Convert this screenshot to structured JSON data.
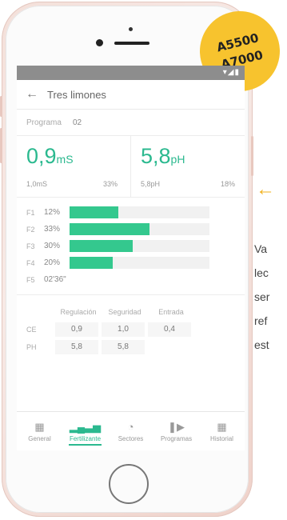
{
  "badge": {
    "line1": "A5500",
    "line2": "A7000"
  },
  "app": {
    "title": "Tres limones",
    "status_icons": "▾◢▮"
  },
  "programa": {
    "label": "Programa",
    "value": "02"
  },
  "ce": {
    "value": "0,9",
    "unit": "mS",
    "set": "1,0mS",
    "percent": "33%"
  },
  "ph": {
    "value": "5,8",
    "unit": "pH",
    "set": "5,8pH",
    "percent": "18%"
  },
  "fertilizers": [
    {
      "label": "F1",
      "percent": "12%",
      "level": 0.35
    },
    {
      "label": "F2",
      "percent": "33%",
      "level": 0.57
    },
    {
      "label": "F3",
      "percent": "30%",
      "level": 0.45
    },
    {
      "label": "F4",
      "percent": "20%",
      "level": 0.31
    }
  ],
  "f5": {
    "label": "F5",
    "time": "02'36\""
  },
  "table": {
    "headers": [
      "Regulación",
      "Seguridad",
      "Entrada"
    ],
    "rows": [
      {
        "label": "CE",
        "values": [
          "0,9",
          "1,0",
          "0,4"
        ]
      },
      {
        "label": "PH",
        "values": [
          "5,8",
          "5,8"
        ]
      }
    ]
  },
  "tabs": [
    {
      "label": "General",
      "icon": "dashboard-icon"
    },
    {
      "label": "Fertilizante",
      "icon": "bars-icon",
      "active": true
    },
    {
      "label": "Sectores",
      "icon": "pie-icon"
    },
    {
      "label": "Programas",
      "icon": "play-icon"
    },
    {
      "label": "Historial",
      "icon": "calendar-icon"
    }
  ],
  "side_text": [
    "Va",
    "lec",
    "ser",
    "ref",
    "est"
  ],
  "colors": {
    "accent": "#2bb98f",
    "bar": "#34c88e",
    "badge": "#f7c32e",
    "arrow": "#f2b11b"
  }
}
